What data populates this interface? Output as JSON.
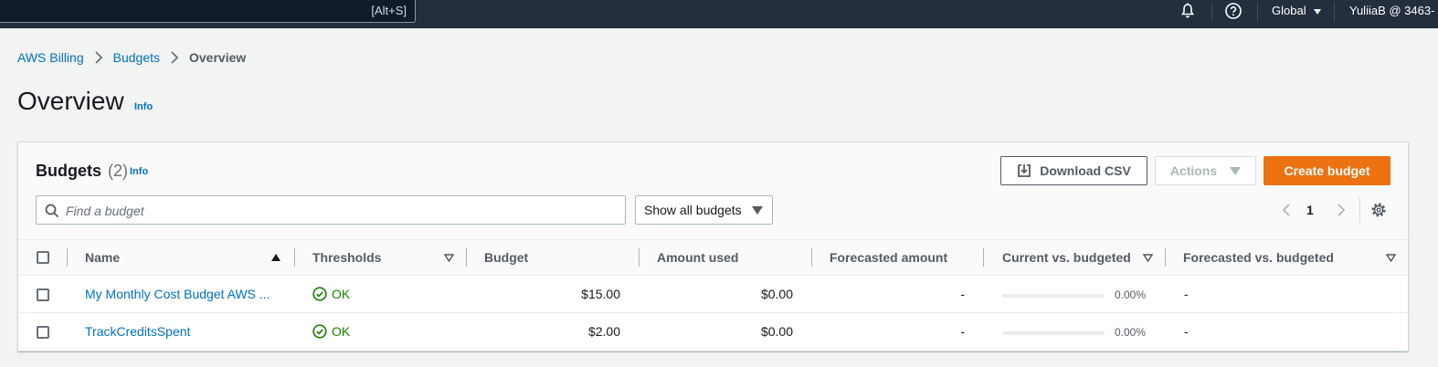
{
  "topnav": {
    "search_shortcut": "[Alt+S]",
    "region": "Global",
    "account": "YuliiaB @ 3463-"
  },
  "breadcrumb": {
    "items": [
      "AWS Billing",
      "Budgets"
    ],
    "current": "Overview"
  },
  "page": {
    "title": "Overview",
    "info": "Info"
  },
  "budgets": {
    "title": "Budgets",
    "count": "(2)",
    "info": "Info",
    "download_label": "Download CSV",
    "actions_label": "Actions",
    "create_label": "Create budget",
    "search_placeholder": "Find a budget",
    "filter_value": "Show all budgets",
    "page": "1"
  },
  "table": {
    "columns": [
      "Name",
      "Thresholds",
      "Budget",
      "Amount used",
      "Forecasted amount",
      "Current vs. budgeted",
      "Forecasted vs. budgeted"
    ],
    "rows": [
      {
        "name": "My Monthly Cost Budget AWS ...",
        "threshold": "OK",
        "budget": "$15.00",
        "amount_used": "$0.00",
        "forecasted": "-",
        "current_pct": "0.00%",
        "current_fraction": 0,
        "forecasted_vs": "-"
      },
      {
        "name": "TrackCreditsSpent",
        "threshold": "OK",
        "budget": "$2.00",
        "amount_used": "$0.00",
        "forecasted": "-",
        "current_pct": "0.00%",
        "current_fraction": 0,
        "forecasted_vs": "-"
      }
    ]
  },
  "colors": {
    "nav_bg": "#232f3e",
    "link": "#0073bb",
    "primary": "#ec7211",
    "ok": "#1d8102"
  }
}
